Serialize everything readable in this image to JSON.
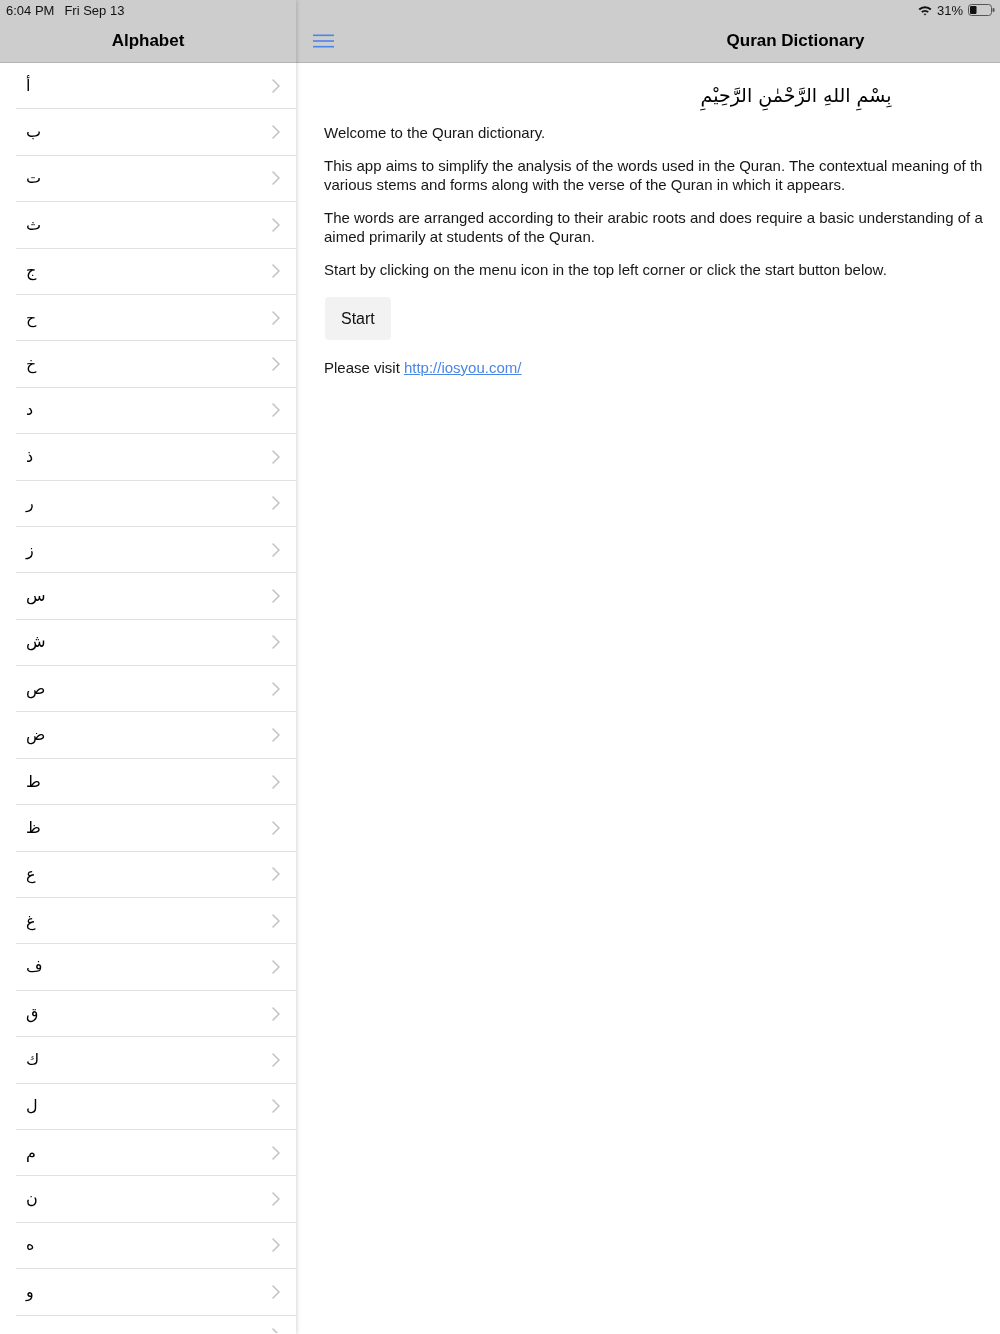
{
  "status_bar": {
    "time": "6:04 PM",
    "date": "Fri Sep 13",
    "battery_percent": "31%"
  },
  "sidebar": {
    "title": "Alphabet",
    "items": [
      {
        "kind": "letter",
        "letter": "أ"
      },
      {
        "kind": "letter",
        "letter": "ب"
      },
      {
        "kind": "letter",
        "letter": "ت"
      },
      {
        "kind": "letter",
        "letter": "ث"
      },
      {
        "kind": "letter",
        "letter": "ج"
      },
      {
        "kind": "letter",
        "letter": "ح"
      },
      {
        "kind": "letter",
        "letter": "خ"
      },
      {
        "kind": "letter",
        "letter": "د"
      },
      {
        "kind": "letter",
        "letter": "ذ"
      },
      {
        "kind": "letter",
        "letter": "ر"
      },
      {
        "kind": "letter",
        "letter": "ز"
      },
      {
        "kind": "letter",
        "letter": "س"
      },
      {
        "kind": "letter",
        "letter": "ش"
      },
      {
        "kind": "letter",
        "letter": "ص"
      },
      {
        "kind": "letter",
        "letter": "ض"
      },
      {
        "kind": "letter",
        "letter": "ط"
      },
      {
        "kind": "letter",
        "letter": "ظ"
      },
      {
        "kind": "letter",
        "letter": "ع"
      },
      {
        "kind": "letter",
        "letter": "غ"
      },
      {
        "kind": "letter",
        "letter": "ف"
      },
      {
        "kind": "letter",
        "letter": "ق"
      },
      {
        "kind": "letter",
        "letter": "ك"
      },
      {
        "kind": "letter",
        "letter": "ل"
      },
      {
        "kind": "letter",
        "letter": "م"
      },
      {
        "kind": "letter",
        "letter": "ن"
      },
      {
        "kind": "letter",
        "letter": "ه"
      },
      {
        "kind": "letter",
        "letter": "و"
      },
      {
        "kind": "cut-off"
      }
    ]
  },
  "detail": {
    "title": "Quran Dictionary",
    "heading": "بِسْمِ اللهِ الرَّحْمٰنِ الرَّحِيْمِ",
    "paragraphs": [
      {
        "lines": [
          "Welcome to the Quran dictionary."
        ]
      },
      {
        "lines": [
          "This app aims to simplify the analysis of the words used in the Quran. The contextual meaning of th",
          "various stems and forms along with the verse of the Quran in which it appears."
        ]
      },
      {
        "lines": [
          "The words are arranged according to their arabic roots and does require a basic understanding of a",
          "aimed primarily at students of the Quran."
        ]
      },
      {
        "lines": [
          "Start by clicking on the menu icon in the top left corner or click the start button below."
        ]
      }
    ],
    "start_button": "Start",
    "visit": {
      "text": "Please visit",
      "link": "http://iosyou.com/"
    }
  }
}
